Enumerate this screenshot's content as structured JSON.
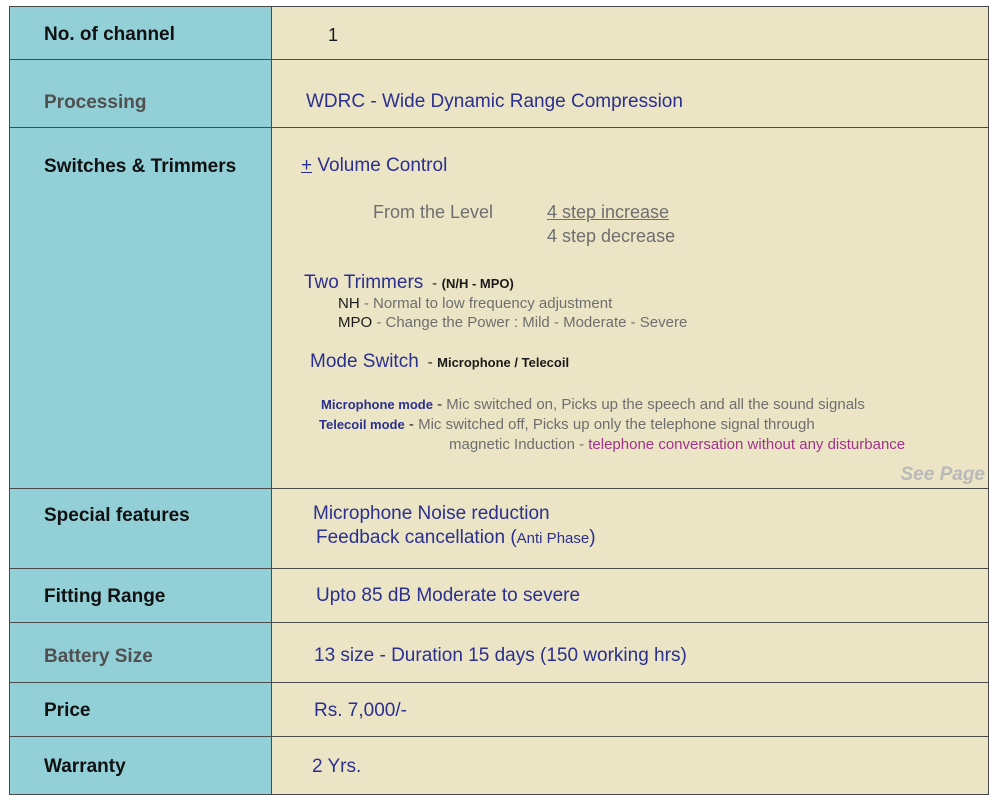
{
  "rows": {
    "channel": {
      "label": "No. of channel",
      "value": "1"
    },
    "processing": {
      "label": "Processing",
      "value": "WDRC - Wide Dynamic Range Compression"
    },
    "switches": {
      "label": "Switches & Trimmers",
      "volume_plus": "+",
      "volume_label": "Volume Control",
      "level_label": "From the Level",
      "level_increase": "4 step increase",
      "level_decrease": "4 step decrease",
      "trimmers_title": "Two Trimmers",
      "trimmers_dash": "-",
      "trimmers_codes": "(N/H  - MPO)",
      "nh_code": "NH",
      "nh_desc": " - Normal to low frequency adjustment",
      "mpo_code": "MPO",
      "mpo_desc": " - Change the Power  :   Mild - Moderate - Severe",
      "mode_title": "Mode Switch",
      "mode_dash": "-",
      "mode_options": "Microphone / Telecoil",
      "mic_mode_label": "Microphone mode",
      "mic_mode_dash": " - ",
      "mic_mode_desc": "Mic switched on, Picks up the speech and all the sound signals",
      "tele_mode_label": "Telecoil mode",
      "tele_mode_dash": " - ",
      "tele_mode_desc1": "Mic switched off, Picks up only the telephone signal through",
      "tele_mode_desc2": "magnetic Induction - ",
      "tele_mode_highlight": "telephone conversation without any disturbance",
      "see_page": "See Page"
    },
    "special": {
      "label": "Special features",
      "line1": "Microphone Noise reduction",
      "line2_main": "Feedback cancellation (",
      "line2_small": "Anti Phase",
      "line2_end": ")"
    },
    "fitting": {
      "label": "Fitting Range",
      "value": "Upto 85 dB  Moderate  to severe"
    },
    "battery": {
      "label": "Battery Size",
      "value": "13 size - Duration 15 days (150 working hrs)"
    },
    "price": {
      "label": "Price",
      "value": "Rs. 7,000/-"
    },
    "warranty": {
      "label": "Warranty",
      "value": "2 Yrs."
    }
  },
  "colors": {
    "label_bg": "#92cfd6",
    "value_bg": "#ebe5c6",
    "value_text": "#2b2f8f",
    "highlight": "#a3338a",
    "see_page": "#b9b9b9"
  }
}
